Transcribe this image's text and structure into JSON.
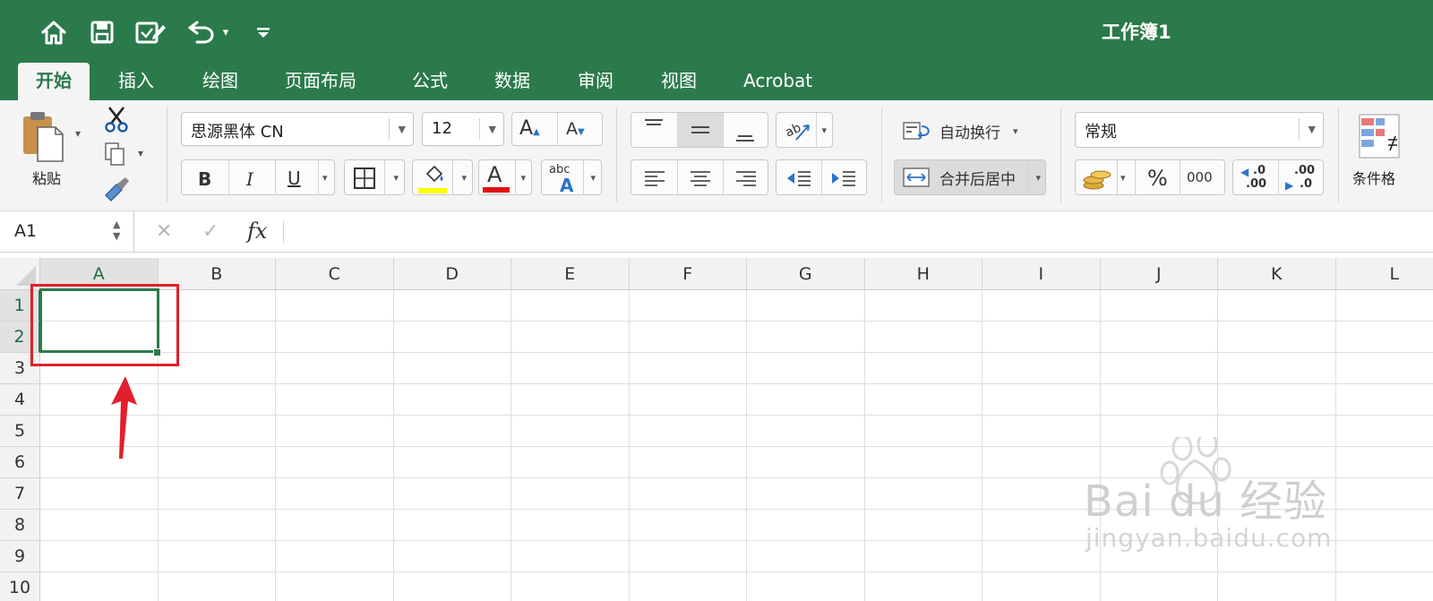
{
  "window": {
    "title": "工作簿1"
  },
  "quick_access": {
    "icons": [
      "home-icon",
      "save-icon",
      "edit-doc-icon",
      "undo-icon",
      "customize-icon"
    ],
    "undo_dropdown": "▾",
    "customize_glyph": "≡"
  },
  "tabs": [
    {
      "label": "开始",
      "active": true
    },
    {
      "label": "插入"
    },
    {
      "label": "绘图"
    },
    {
      "label": "页面布局"
    },
    {
      "label": "公式"
    },
    {
      "label": "数据"
    },
    {
      "label": "审阅"
    },
    {
      "label": "视图"
    },
    {
      "label": "Acrobat"
    }
  ],
  "clipboard": {
    "paste_label": "粘贴"
  },
  "font": {
    "name": "思源黑体 CN",
    "size": "12",
    "grow_label": "A",
    "shrink_label": "A",
    "bold": "B",
    "italic": "I",
    "underline": "U",
    "font_color_label": "A",
    "phonetic_top": "abc",
    "phonetic_bottom": "A",
    "highlight_color": "#ffff00",
    "font_color": "#e01010"
  },
  "alignment": {
    "wrap_label": "自动换行",
    "merge_label": "合并后居中"
  },
  "number": {
    "format": "常规",
    "percent": "%",
    "comma": "000",
    "inc_decimal_top": ".0",
    "inc_decimal_bottom": ".00",
    "dec_decimal_top": ".00",
    "dec_decimal_bottom": ".0"
  },
  "styles": {
    "conditional_label": "条件格"
  },
  "formula_bar": {
    "name_box": "A1",
    "cancel": "✕",
    "enter": "✓",
    "fx": "fx",
    "value": ""
  },
  "sheet": {
    "columns": [
      "A",
      "B",
      "C",
      "D",
      "E",
      "F",
      "G",
      "H",
      "I",
      "J",
      "K",
      "L"
    ],
    "rows": [
      "1",
      "2",
      "3",
      "4",
      "5",
      "6",
      "7",
      "8",
      "9",
      "10"
    ],
    "selected_col": "A",
    "selected_rows": [
      "1",
      "2"
    ]
  },
  "watermark": {
    "brand": "Bai du 经验",
    "url": "jingyan.baidu.com"
  },
  "colors": {
    "accent": "#2b7a4b",
    "annotation": "#e0202a"
  }
}
